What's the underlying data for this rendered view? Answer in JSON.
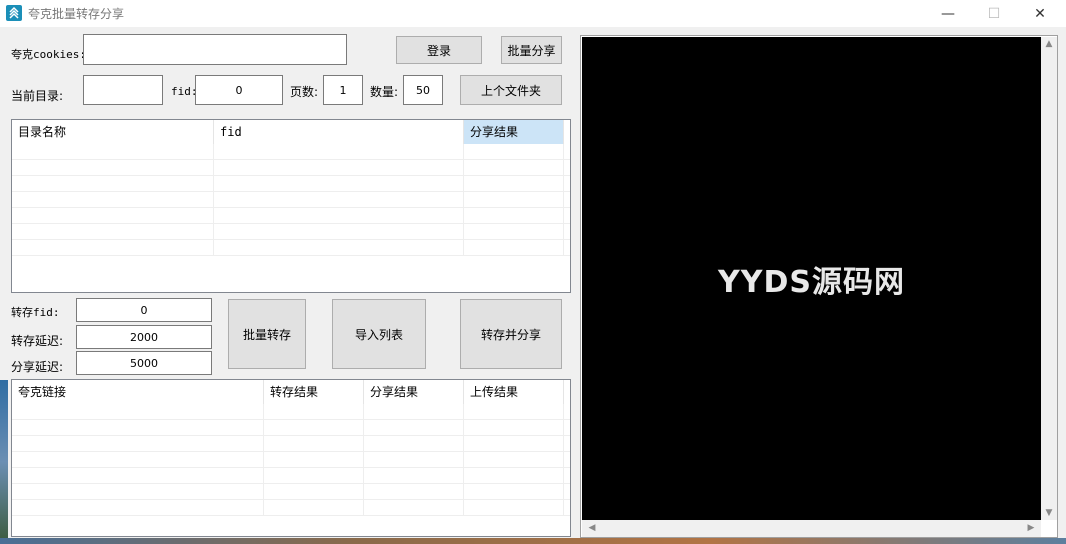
{
  "window": {
    "title": "夸克批量转存分享",
    "min_glyph": "—",
    "max_glyph": "☐",
    "close_glyph": "✕"
  },
  "form": {
    "cookies_label": "夸克cookies:",
    "cookies_value": "",
    "login_label": "登录",
    "batch_share_label": "批量分享",
    "current_dir_label": "当前目录:",
    "current_dir_value": "",
    "fid_label": "fid:",
    "fid_value": "0",
    "pages_label": "页数:",
    "pages_value": "1",
    "count_label": "数量:",
    "count_value": "50",
    "parent_folder_label": "上个文件夹"
  },
  "dir_table": {
    "columns": [
      "目录名称",
      "fid",
      "分享结果"
    ],
    "selected_column": 2,
    "row_count": 7
  },
  "transfer": {
    "fid_label": "转存fid:",
    "fid_value": "0",
    "transfer_delay_label": "转存延迟:",
    "transfer_delay_value": "2000",
    "share_delay_label": "分享延迟:",
    "share_delay_value": "5000",
    "batch_transfer_label": "批量转存",
    "import_list_label": "导入列表",
    "transfer_share_label": "转存并分享"
  },
  "link_table": {
    "columns": [
      "夸克链接",
      "转存结果",
      "分享结果",
      "上传结果"
    ],
    "row_count": 7
  },
  "browser": {
    "watermark": "YYDS源码网"
  },
  "icons": {
    "app": "quark-app-icon",
    "scroll_up": "▲",
    "scroll_down": "▼",
    "scroll_left": "◀",
    "scroll_right": "▶"
  }
}
